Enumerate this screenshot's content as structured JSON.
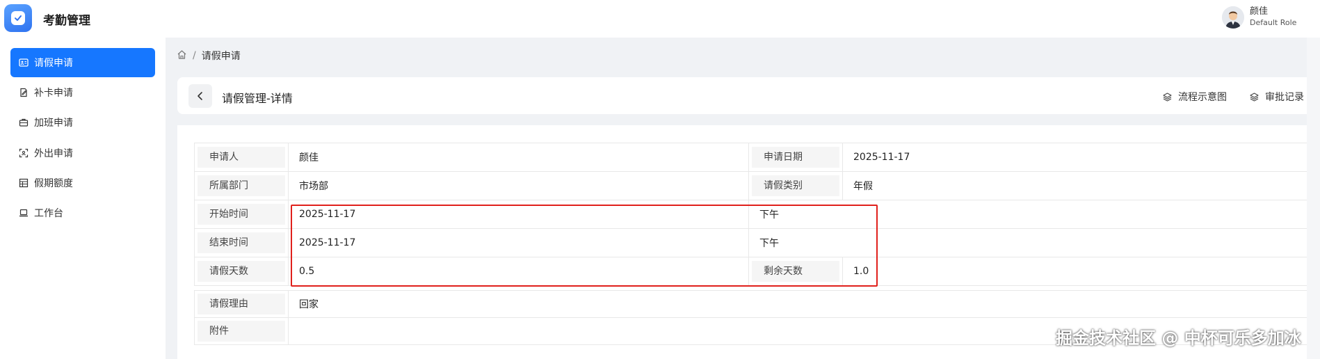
{
  "app": {
    "title": "考勤管理"
  },
  "user": {
    "name": "颜佳",
    "role": "Default Role"
  },
  "sidebar": {
    "items": [
      {
        "label": "请假申请",
        "icon": "id-card-icon",
        "active": true
      },
      {
        "label": "补卡申请",
        "icon": "edit-doc-icon",
        "active": false
      },
      {
        "label": "加班申请",
        "icon": "briefcase-icon",
        "active": false
      },
      {
        "label": "外出申请",
        "icon": "scan-icon",
        "active": false
      },
      {
        "label": "假期额度",
        "icon": "table-icon",
        "active": false
      },
      {
        "label": "工作台",
        "icon": "laptop-icon",
        "active": false
      }
    ]
  },
  "breadcrumb": {
    "current": "请假申请"
  },
  "detail": {
    "title": "请假管理-详情",
    "actions": {
      "flow": "流程示意图",
      "records": "审批记录"
    }
  },
  "fields": {
    "applicant_label": "申请人",
    "applicant": "颜佳",
    "apply_date_label": "申请日期",
    "apply_date": "2025-11-17",
    "dept_label": "所属部门",
    "dept": "市场部",
    "type_label": "请假类别",
    "type": "年假",
    "start_label": "开始时间",
    "start_date": "2025-11-17",
    "start_half": "下午",
    "end_label": "结束时间",
    "end_date": "2025-11-17",
    "end_half": "下午",
    "days_label": "请假天数",
    "days": "0.5",
    "remain_label": "剩余天数",
    "remain": "1.0",
    "reason_label": "请假理由",
    "reason": "回家",
    "attach_label": "附件",
    "attach": ""
  },
  "watermark": "掘金技术社区 @ 中杯可乐多加冰",
  "colors": {
    "primary": "#1677ff",
    "highlight_border": "#e0201b"
  }
}
